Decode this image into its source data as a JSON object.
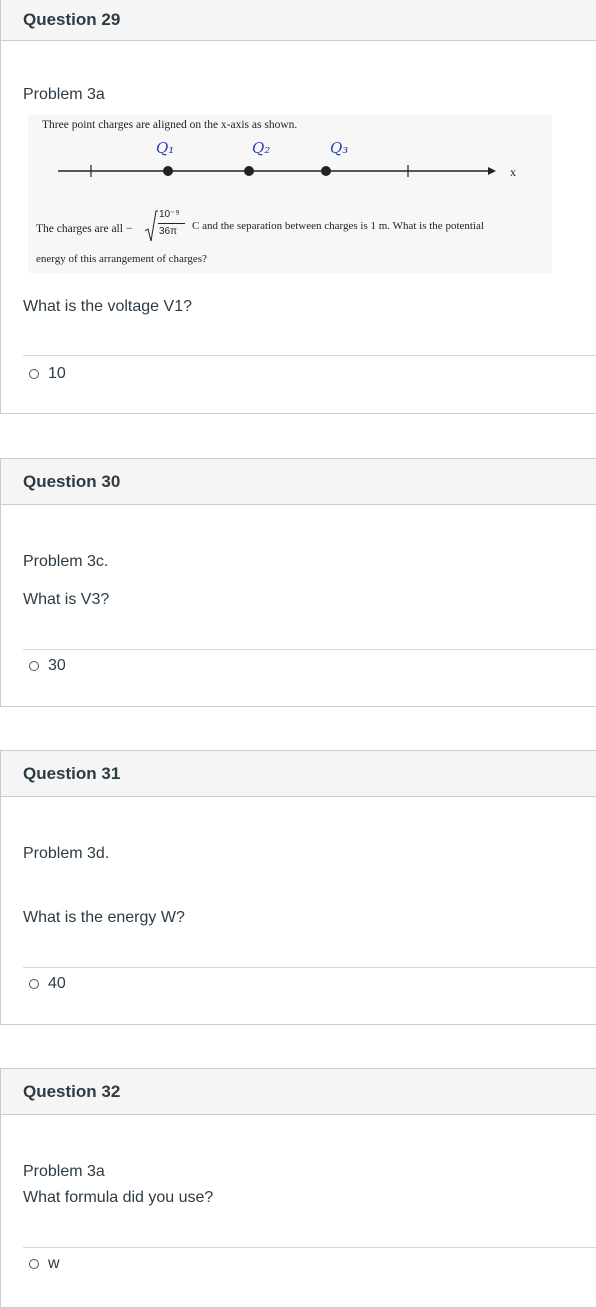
{
  "questions": [
    {
      "title": "Question 29",
      "problem": "Problem 3a",
      "prompt": "What is the voltage V1?",
      "answer": "10",
      "figure": {
        "intro": "Three point charges are aligned on the x-axis as shown.",
        "labels": [
          "Q₁",
          "Q₂",
          "Q₃"
        ],
        "axis_label": "x",
        "body_before": "The charges are all −",
        "numerator": "10⁻⁹",
        "denominator": "36π",
        "body_after": "C and the separation between charges is 1 m. What is the potential",
        "body_line2": "energy of this arrangement of charges?"
      }
    },
    {
      "title": "Question 30",
      "problem": "Problem 3c.",
      "prompt": "What is V3?",
      "answer": "30"
    },
    {
      "title": "Question 31",
      "problem": "Problem 3d.",
      "prompt": "What is the energy W?",
      "answer": "40"
    },
    {
      "title": "Question 32",
      "problem": "Problem 3a",
      "prompt": "What formula did you use?",
      "answer": "w"
    }
  ]
}
